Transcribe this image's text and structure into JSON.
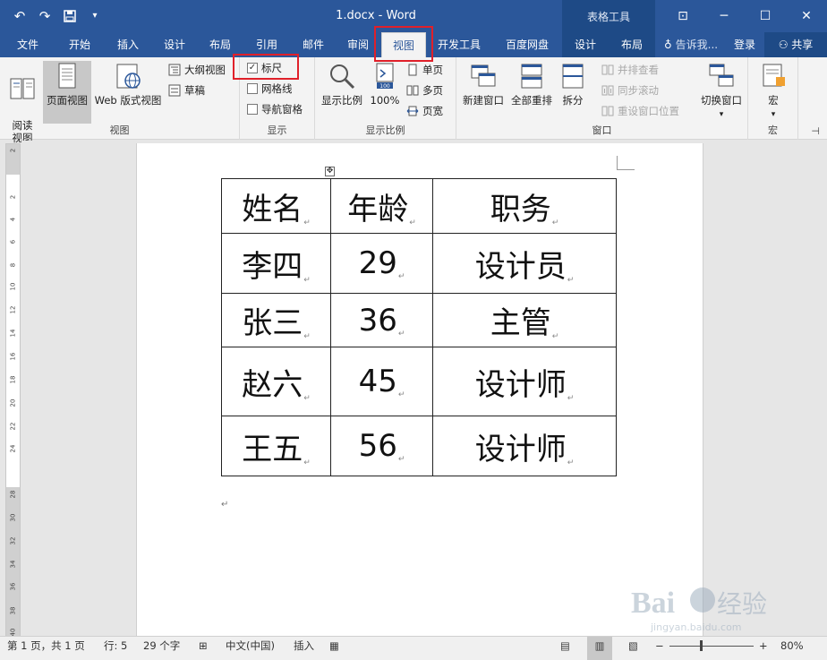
{
  "titlebar": {
    "doc_title": "1.docx - Word",
    "context_group": "表格工具"
  },
  "tabs": [
    {
      "label": "文件"
    },
    {
      "label": "开始"
    },
    {
      "label": "插入"
    },
    {
      "label": "设计"
    },
    {
      "label": "布局"
    },
    {
      "label": "引用"
    },
    {
      "label": "邮件"
    },
    {
      "label": "审阅"
    },
    {
      "label": "视图",
      "active": true
    },
    {
      "label": "开发工具"
    },
    {
      "label": "百度网盘"
    },
    {
      "label": "设计"
    },
    {
      "label": "布局"
    }
  ],
  "tell_me": "告诉我...",
  "login": "登录",
  "share": "共享",
  "ribbon": {
    "views": {
      "group_label": "视图",
      "read_mode": "阅读\n视图",
      "print_layout": "页面视图",
      "web_layout": "Web 版式视图",
      "outline": "大纲视图",
      "draft": "草稿"
    },
    "show": {
      "group_label": "显示",
      "ruler": "标尺",
      "gridlines": "网格线",
      "nav_pane": "导航窗格",
      "ruler_checked": true
    },
    "zoom": {
      "group_label": "显示比例",
      "zoom": "显示比例",
      "hundred": "100%",
      "one_page": "单页",
      "multi_page": "多页",
      "page_width": "页宽"
    },
    "window": {
      "group_label": "窗口",
      "new_window": "新建窗口",
      "arrange_all": "全部重排",
      "split": "拆分",
      "side_by_side": "并排查看",
      "sync_scroll": "同步滚动",
      "reset_position": "重设窗口位置",
      "switch_windows": "切换窗口"
    },
    "macros": {
      "group_label": "宏",
      "macros": "宏"
    }
  },
  "ruler_numbers": [
    "2",
    "2",
    "4",
    "6",
    "8",
    "10",
    "12",
    "14",
    "16",
    "18",
    "20",
    "22",
    "24",
    "28",
    "30",
    "32",
    "34",
    "36",
    "38",
    "40"
  ],
  "table": {
    "header": [
      "姓名",
      "年龄",
      "职务"
    ],
    "rows": [
      [
        "李四",
        "29",
        "设计员"
      ],
      [
        "张三",
        "36",
        "主管"
      ],
      [
        "赵六",
        "45",
        "设计师"
      ],
      [
        "王五",
        "56",
        "设计师"
      ]
    ]
  },
  "status": {
    "page": "第 1 页，共 1 页",
    "line": "行: 5",
    "words": "29 个字",
    "language": "中文(中国)",
    "mode": "插入",
    "zoom": "80%"
  }
}
